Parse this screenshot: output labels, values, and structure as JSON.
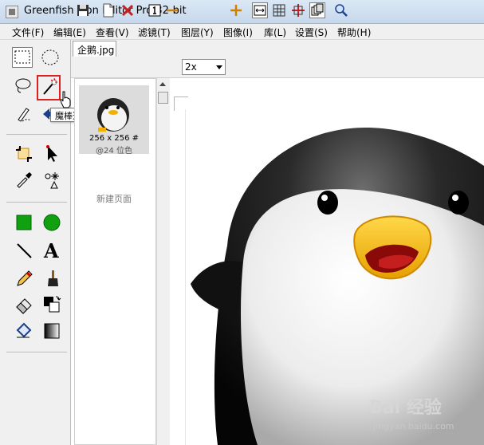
{
  "window": {
    "title": "Greenfish Icon Editor Pro 32-bit"
  },
  "menu": [
    "文件(F)",
    "编辑(E)",
    "查看(V)",
    "滤镜(T)",
    "图层(Y)",
    "图像(I)",
    "库(L)",
    "设置(S)",
    "帮助(H)"
  ],
  "tools": {
    "tooltip": "魔棒选择 (W)",
    "items": [
      "rect-select",
      "ellipse-select",
      "lasso-select",
      "magic-wand",
      "pen",
      "move-left",
      "crop",
      "pointer",
      "eyedropper",
      "sparkle",
      "rectangle",
      "ellipse",
      "line",
      "text",
      "pencil",
      "brush",
      "eraser",
      "swap-colors",
      "fill",
      "gradient"
    ],
    "active": "magic-wand",
    "highlighted": "magic-wand"
  },
  "document": {
    "tab_label": "企鹅.jpg"
  },
  "toolbar": {
    "zoom_value": "2x",
    "buttons": [
      "save",
      "new-page",
      "delete-page",
      "actual-size",
      "zoom-out",
      "zoom-in",
      "fit",
      "grid",
      "crosshair",
      "layers",
      "magnifier"
    ]
  },
  "pages": {
    "thumb_size": "256 x 256 #",
    "thumb_depth": "@24 位色",
    "new_page": "新建页面"
  },
  "watermark": {
    "logo": "Bai 经验",
    "url": "jingyan.baidu.com"
  },
  "colors": {
    "highlight": "#e02020",
    "beak": "#f4b000",
    "shape_fill": "#10a010"
  }
}
